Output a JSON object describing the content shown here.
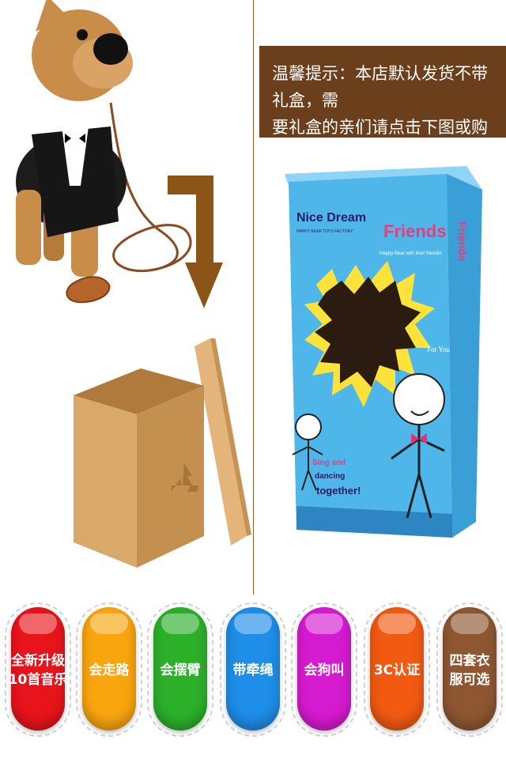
{
  "notice": {
    "line1": "温馨提示：本店默认发货不带礼盒，需",
    "line2": "要礼盒的亲们请点击下图或购买套餐!"
  },
  "gift_box": {
    "brand": "Nice Dream",
    "brand_tagline": "HAPPY BEAR TOYS FACTORY",
    "friends_title": "Friends",
    "friends_tagline": "Happy Bear with their friends!",
    "side_title": "Friends",
    "sing_text": "Sing and",
    "dancing_text": "dancing",
    "together_text": "together!",
    "for_you": "For You"
  },
  "features": [
    {
      "label": "全新升级\n10首音乐",
      "color": "#e8141b"
    },
    {
      "label": "会走路",
      "color": "#f9a50e"
    },
    {
      "label": "会摆臂",
      "color": "#2cb02a"
    },
    {
      "label": "带牵绳",
      "color": "#1e8ee8"
    },
    {
      "label": "会狗叫",
      "color": "#d51bd0"
    },
    {
      "label": "3C认证",
      "color": "#f25a12"
    },
    {
      "label": "四套衣\n服可选",
      "color": "#8e5732"
    }
  ],
  "colors": {
    "notice_bg": "#6b3f1c",
    "arrow": "#8b5517",
    "box_cardboard": "#d8a86b",
    "gift_box_blue": "#4fb6ea"
  }
}
